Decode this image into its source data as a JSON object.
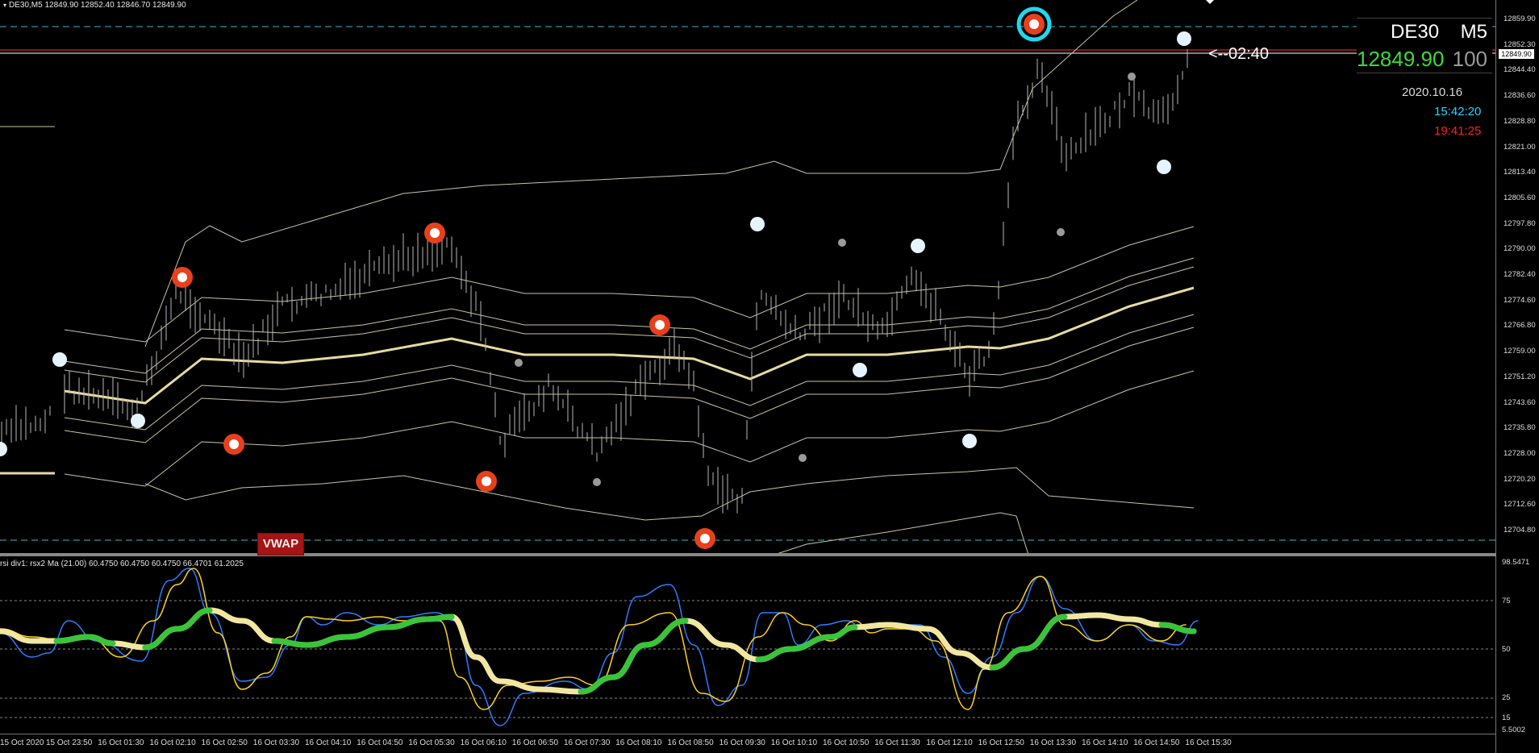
{
  "chart": {
    "symbol": "DE30",
    "timeframe": "M5",
    "header": "DE30,M5  12849.90 12852.40 12846.70 12849.90",
    "ohlc": {
      "open": 12849.9,
      "high": 12852.4,
      "low": 12846.7,
      "close": 12849.9
    },
    "bid_price": "12849.90",
    "spread": "100",
    "date": "2020.10.16",
    "server_time": "15:42:20",
    "local_time": "19:41:25",
    "countdown": "<--02:40",
    "current_price_badge": "12849.90",
    "vwap_label": "VWAP",
    "colors": {
      "background": "#000000",
      "vwap": "#e6dba0",
      "bands": "#c9c4a8",
      "candles": "#b8b8b8",
      "guide_dashed": "#3fb6c8",
      "price_line": "#ff3030",
      "high_marker": "#e8401c",
      "low_marker": "#e6f4ff",
      "text_green": "#3fd83f",
      "text_cyan": "#2ad4ff",
      "text_red": "#ff2020"
    }
  },
  "indicator": {
    "title": "rsi div1: rsx2 Ma (21.00) 60.4750 60.4750 60.4750 66.4701 61.2025",
    "levels": [
      "75",
      "50",
      "25",
      "15"
    ],
    "max_label": "98.5471",
    "min_label": "5.5002",
    "colors": {
      "fast": "#2f7cff",
      "slow": "#ffd21f",
      "ma_up": "#39c43a",
      "ma_down": "#f2e7a0"
    }
  },
  "price_axis": {
    "labels": [
      "12859.90",
      "12852.30",
      "12844.40",
      "12836.60",
      "12828.80",
      "12821.00",
      "12813.40",
      "12805.60",
      "12797.80",
      "12790.00",
      "12782.40",
      "12774.60",
      "12766.80",
      "12759.00",
      "12751.20",
      "12743.60",
      "12735.80",
      "12728.00",
      "12720.20",
      "12712.60",
      "12704.80"
    ]
  },
  "time_axis": {
    "labels": [
      "15 Oct 2020",
      "15 Oct 23:50",
      "16 Oct 01:30",
      "16 Oct 02:10",
      "16 Oct 02:50",
      "16 Oct 03:30",
      "16 Oct 04:10",
      "16 Oct 04:50",
      "16 Oct 05:30",
      "16 Oct 06:10",
      "16 Oct 06:50",
      "16 Oct 07:30",
      "16 Oct 08:10",
      "16 Oct 08:50",
      "16 Oct 09:30",
      "16 Oct 10:10",
      "16 Oct 10:50",
      "16 Oct 11:30",
      "16 Oct 12:10",
      "16 Oct 12:50",
      "16 Oct 13:30",
      "16 Oct 14:10",
      "16 Oct 14:50",
      "16 Oct 15:30"
    ]
  }
}
